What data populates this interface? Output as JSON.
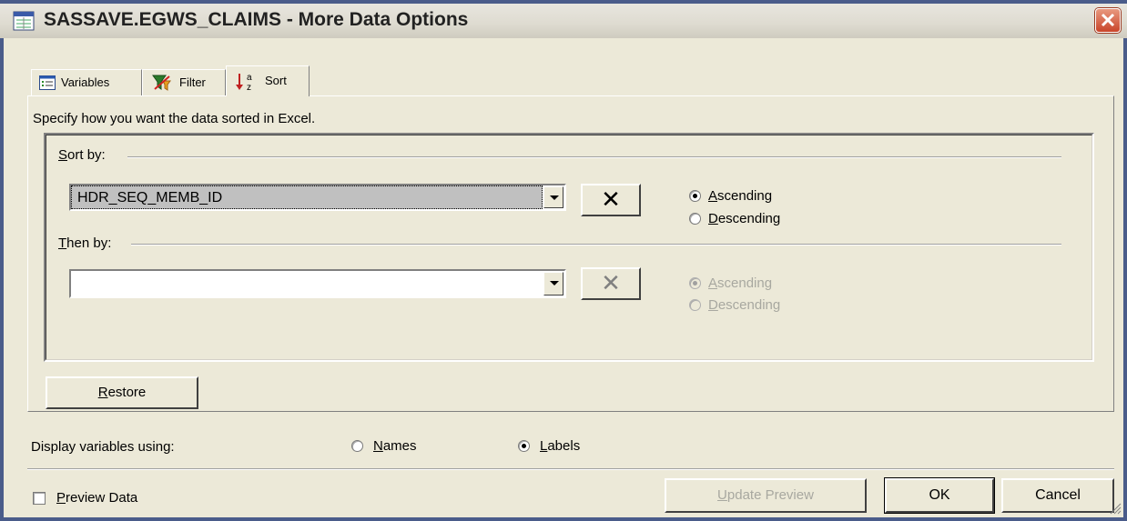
{
  "window": {
    "title": "SASSAVE.EGWS_CLAIMS - More Data Options"
  },
  "tabs": [
    {
      "label": "Variables",
      "icon": "list-icon"
    },
    {
      "label": "Filter",
      "icon": "funnel-icon"
    },
    {
      "label": "Sort",
      "icon": "sort-az-icon",
      "active": true
    }
  ],
  "sort_tab": {
    "instruction": "Specify how you want the data sorted in Excel.",
    "sort_by": {
      "label_prefix": "",
      "label_mnemonic": "S",
      "label_rest": "ort by:",
      "value": "HDR_SEQ_MEMB_ID",
      "clear_glyph": "✕",
      "ascending": {
        "mnemonic": "A",
        "rest": "scending",
        "checked": true
      },
      "descending": {
        "mnemonic": "D",
        "rest": "escending",
        "checked": false
      }
    },
    "then_by": {
      "label_mnemonic": "T",
      "label_rest": "hen by:",
      "value": "",
      "clear_glyph": "✕",
      "ascending": {
        "mnemonic": "A",
        "rest": "scending",
        "checked": true
      },
      "descending": {
        "mnemonic": "D",
        "rest": "escending",
        "checked": false
      }
    },
    "restore": {
      "mnemonic": "R",
      "rest": "estore"
    }
  },
  "display": {
    "label": "Display variables using:",
    "names": {
      "mnemonic": "N",
      "rest": "ames",
      "checked": false
    },
    "labels": {
      "mnemonic": "L",
      "rest": "abels",
      "checked": true
    }
  },
  "footer": {
    "preview": {
      "mnemonic": "P",
      "rest": "review Data",
      "checked": false
    },
    "update_preview": {
      "mnemonic": "U",
      "rest": "pdate Preview"
    },
    "ok": "OK",
    "cancel": "Cancel"
  },
  "colors": {
    "selection": "#c0c0c0",
    "frame": "#4a5c8a",
    "close": "#c9452a"
  }
}
